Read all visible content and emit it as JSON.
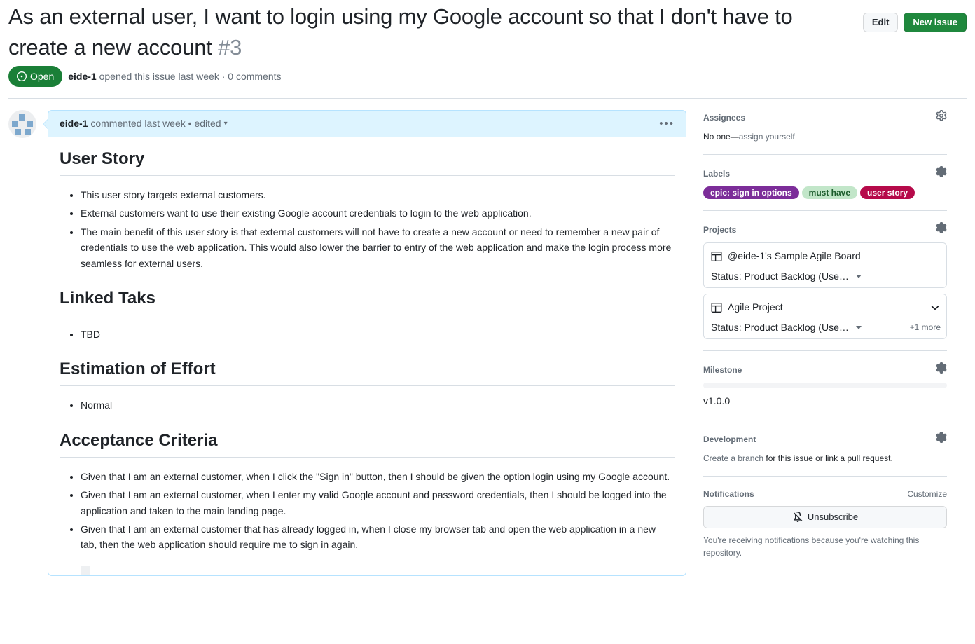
{
  "header": {
    "title": "As an external user, I want to login using my Google account so that I don't have to create a new account",
    "issue_number": "#3",
    "state": "Open",
    "state_icon": "issue-opened-icon",
    "state_color": "#1a7f37",
    "author": "eide-1",
    "meta_opened": " opened this issue last week · 0 comments",
    "edit_label": "Edit",
    "new_issue_label": "New issue"
  },
  "comment": {
    "author": "eide-1",
    "meta": " commented last week • edited",
    "kebab": "•••",
    "sections": [
      {
        "heading": "User Story",
        "items": [
          "This user story targets external customers.",
          "External customers want to use their existing Google account credentials to login to the web application.",
          "The main benefit of this user story is that external customers will not have to create a new account or need to remember a new pair of credentials to use the web application. This would also lower the barrier to entry of the web application and make the login process more seamless for external users."
        ]
      },
      {
        "heading": "Linked Taks",
        "items": [
          "TBD"
        ]
      },
      {
        "heading": "Estimation of Effort",
        "items": [
          "Normal"
        ]
      },
      {
        "heading": "Acceptance Criteria",
        "items": [
          "Given that I am an external customer, when I click the \"Sign in\" button, then I should be given the option login using my Google account.",
          "Given that I am an external customer, when I enter my valid Google account and password credentials, then I should be logged into the application and taken to the main landing page.",
          "Given that I am an external customer that has already logged in, when I close my browser tab and open the web application in a new tab, then the web application should require me to sign in again."
        ]
      }
    ]
  },
  "sidebar": {
    "assignees": {
      "title": "Assignees",
      "gear_icon": "gear-icon",
      "none_text": "No one—",
      "assign_link": "assign yourself"
    },
    "labels": {
      "title": "Labels",
      "gear_icon": "gear-icon",
      "items": [
        {
          "text": "epic: sign in options",
          "bg": "#7c2d99",
          "fg": "#ffffff"
        },
        {
          "text": "must have",
          "bg": "#c2e6c9",
          "fg": "#1c5c2c"
        },
        {
          "text": "user story",
          "bg": "#b60a4a",
          "fg": "#ffffff"
        }
      ]
    },
    "projects": {
      "title": "Projects",
      "gear_icon": "gear-icon",
      "cards": [
        {
          "name": "@eide-1's Sample Agile Board",
          "icon": "project-table-icon",
          "status": "Status: Product Backlog (Use…",
          "has_collapse": false,
          "more": ""
        },
        {
          "name": "Agile Project",
          "icon": "project-table-icon",
          "status": "Status: Product Backlog (Use…",
          "has_collapse": true,
          "more": "+1 more"
        }
      ]
    },
    "milestone": {
      "title": "Milestone",
      "gear_icon": "gear-icon",
      "progress_percent": 0,
      "name": "v1.0.0"
    },
    "development": {
      "title": "Development",
      "gear_icon": "gear-icon",
      "link_text": "Create a branch",
      "rest_text": " for this issue or link a pull request."
    },
    "notifications": {
      "title": "Notifications",
      "customize": "Customize",
      "button_label": "Unsubscribe",
      "bell_icon": "bell-slash-icon",
      "note": "You're receiving notifications because you're watching this repository."
    }
  }
}
